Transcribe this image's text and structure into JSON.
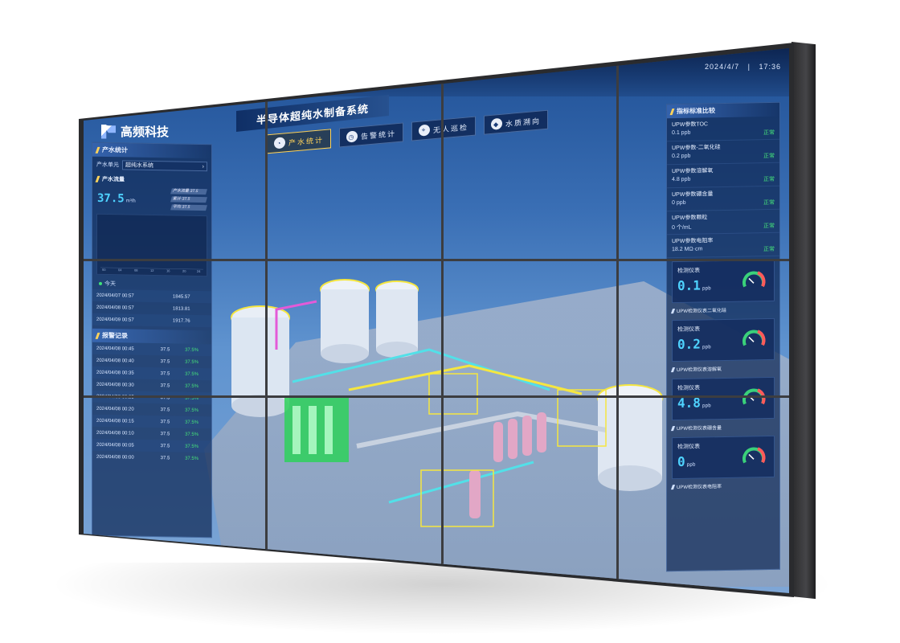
{
  "header": {
    "date": "2024/4/7",
    "separator": "|",
    "time": "17:36",
    "company": "高频科技",
    "system_title": "半导体超纯水制备系统"
  },
  "tabs": [
    {
      "label": "产水统计",
      "icon": "pie-chart-icon",
      "active": true
    },
    {
      "label": "告警统计",
      "icon": "clock-icon",
      "active": false
    },
    {
      "label": "无人巡检",
      "icon": "location-icon",
      "active": false
    },
    {
      "label": "水质溯向",
      "icon": "diamond-icon",
      "active": false
    }
  ],
  "left_panel": {
    "title": "产水统计",
    "select_label": "产水单元",
    "select_value": "超纯水系统",
    "sub_title": "产水流量",
    "flow_value": "37.5",
    "flow_unit": "m³/h",
    "mini_stats": [
      "产水流量 37.5",
      "累计 37.5",
      "平均 37.5"
    ],
    "chart_axis": [
      "00",
      "04",
      "08",
      "12",
      "16",
      "20",
      "24"
    ],
    "legend": "今天",
    "totals": [
      [
        "2024/04/07 00:57",
        "1845.57"
      ],
      [
        "2024/04/08 00:57",
        "1813.81"
      ],
      [
        "2024/04/09 00:57",
        "1917.76"
      ]
    ],
    "records_title": "报警记录",
    "records": [
      [
        "2024/04/08 00:45",
        "37.5",
        "37.5%"
      ],
      [
        "2024/04/08 00:40",
        "37.5",
        "37.5%"
      ],
      [
        "2024/04/08 00:35",
        "37.5",
        "37.5%"
      ],
      [
        "2024/04/08 00:30",
        "37.5",
        "37.5%"
      ],
      [
        "2024/04/08 00:25",
        "37.5",
        "37.5%"
      ],
      [
        "2024/04/08 00:20",
        "37.5",
        "37.5%"
      ],
      [
        "2024/04/08 00:15",
        "37.5",
        "37.5%"
      ],
      [
        "2024/04/08 00:10",
        "37.5",
        "37.5%"
      ],
      [
        "2024/04/08 00:05",
        "37.5",
        "37.5%"
      ],
      [
        "2024/04/08 00:00",
        "37.5",
        "37.5%"
      ]
    ]
  },
  "right_panel": {
    "title": "指标标准比较",
    "comparisons": [
      {
        "label": "UPW参数TOC",
        "value": "0.1 ppb",
        "status": "正常"
      },
      {
        "label": "UPW参数-二氧化硅",
        "value": "0.2 ppb",
        "status": "正常"
      },
      {
        "label": "UPW参数溶解氧",
        "value": "4.8 ppb",
        "status": "正常"
      },
      {
        "label": "UPW参数硼含量",
        "value": "0 ppb",
        "status": "正常"
      },
      {
        "label": "UPW参数颗粒",
        "value": "0 个/mL",
        "status": "正常"
      },
      {
        "label": "UPW参数电阻率",
        "value": "18.2 MΩ·cm",
        "status": "正常"
      }
    ],
    "gauges": [
      {
        "label": "检测仪表",
        "value": "0.1",
        "unit": "ppb",
        "sub": "UPW检测仪表二氧化硅"
      },
      {
        "label": "检测仪表",
        "value": "0.2",
        "unit": "ppb",
        "sub": "UPW检测仪表溶解氧"
      },
      {
        "label": "检测仪表",
        "value": "4.8",
        "unit": "ppb",
        "sub": "UPW检测仪表硼含量"
      },
      {
        "label": "检测仪表",
        "value": "0",
        "unit": "ppb",
        "sub": "UPW检测仪表电阻率"
      }
    ]
  },
  "colors": {
    "accent": "#4fd3ff",
    "ok": "#45e07a",
    "tab_active": "#ffd35a",
    "gauge_green": "#3ad17a",
    "gauge_red": "#ff5a5a"
  }
}
